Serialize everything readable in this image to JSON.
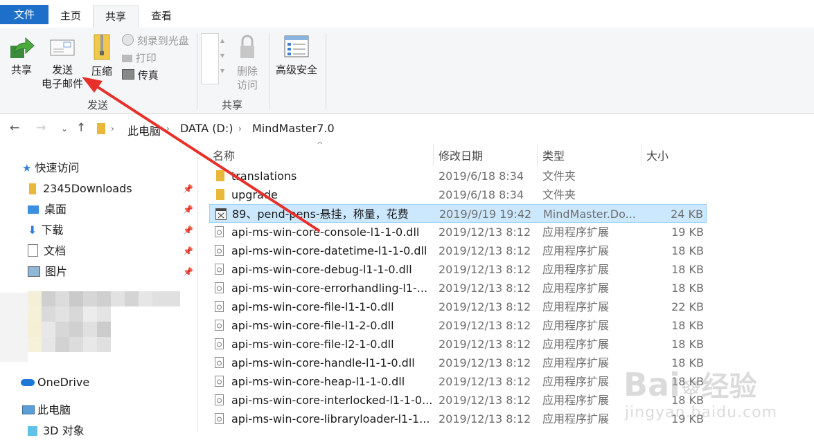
{
  "tabs": {
    "file": "文件",
    "home": "主页",
    "share": "共享",
    "view": "查看"
  },
  "ribbon": {
    "share": "共享",
    "send_email_line1": "发送",
    "send_email_line2": "电子邮件",
    "compress": "压缩",
    "burn": "刻录到光盘",
    "print": "打印",
    "fax": "传真",
    "remove_access_line1": "删除",
    "remove_access_line2": "访问",
    "advanced_security": "高级安全",
    "group_send": "发送",
    "group_share": "共享"
  },
  "address": {
    "this_pc": "此电脑",
    "drive": "DATA (D:)",
    "folder": "MindMaster7.0"
  },
  "nav_pane": {
    "quick_access": "快速访问",
    "items": [
      "2345Downloads",
      "桌面",
      "下载",
      "文档",
      "图片"
    ],
    "onedrive": "OneDrive",
    "this_pc": "此电脑",
    "objects_3d": "3D 对象"
  },
  "columns": {
    "name": "名称",
    "date": "修改日期",
    "type": "类型",
    "size": "大小"
  },
  "files": [
    {
      "name": "translations",
      "date": "2019/6/18 8:34",
      "type": "文件夹",
      "size": "",
      "icon": "folder-icon"
    },
    {
      "name": "upgrade",
      "date": "2019/6/18 8:34",
      "type": "文件夹",
      "size": "",
      "icon": "folder-icon"
    },
    {
      "name": "89、pend-pens-悬挂，称量，花费",
      "date": "2019/9/19 19:42",
      "type": "MindMaster.Do...",
      "size": "24 KB",
      "icon": "mindmaster-file-icon"
    },
    {
      "name": "api-ms-win-core-console-l1-1-0.dll",
      "date": "2019/12/13 8:12",
      "type": "应用程序扩展",
      "size": "19 KB",
      "icon": "dll-file-icon"
    },
    {
      "name": "api-ms-win-core-datetime-l1-1-0.dll",
      "date": "2019/12/13 8:12",
      "type": "应用程序扩展",
      "size": "18 KB",
      "icon": "dll-file-icon"
    },
    {
      "name": "api-ms-win-core-debug-l1-1-0.dll",
      "date": "2019/12/13 8:12",
      "type": "应用程序扩展",
      "size": "18 KB",
      "icon": "dll-file-icon"
    },
    {
      "name": "api-ms-win-core-errorhandling-l1-...",
      "date": "2019/12/13 8:12",
      "type": "应用程序扩展",
      "size": "18 KB",
      "icon": "dll-file-icon"
    },
    {
      "name": "api-ms-win-core-file-l1-1-0.dll",
      "date": "2019/12/13 8:12",
      "type": "应用程序扩展",
      "size": "22 KB",
      "icon": "dll-file-icon"
    },
    {
      "name": "api-ms-win-core-file-l1-2-0.dll",
      "date": "2019/12/13 8:12",
      "type": "应用程序扩展",
      "size": "18 KB",
      "icon": "dll-file-icon"
    },
    {
      "name": "api-ms-win-core-file-l2-1-0.dll",
      "date": "2019/12/13 8:12",
      "type": "应用程序扩展",
      "size": "18 KB",
      "icon": "dll-file-icon"
    },
    {
      "name": "api-ms-win-core-handle-l1-1-0.dll",
      "date": "2019/12/13 8:12",
      "type": "应用程序扩展",
      "size": "18 KB",
      "icon": "dll-file-icon"
    },
    {
      "name": "api-ms-win-core-heap-l1-1-0.dll",
      "date": "2019/12/13 8:12",
      "type": "应用程序扩展",
      "size": "18 KB",
      "icon": "dll-file-icon"
    },
    {
      "name": "api-ms-win-core-interlocked-l1-1-0...",
      "date": "2019/12/13 8:12",
      "type": "应用程序扩展",
      "size": "18 KB",
      "icon": "dll-file-icon"
    },
    {
      "name": "api-ms-win-core-libraryloader-l1-1...",
      "date": "2019/12/13 8:12",
      "type": "应用程序扩展",
      "size": "19 KB",
      "icon": "dll-file-icon"
    }
  ],
  "watermark": {
    "brand": "Bai",
    "brand_cn": "经验",
    "url": "jingyan.baidu.com"
  },
  "colors": {
    "accent": "#1e6fc9",
    "selection": "#cce8ff",
    "arrow": "#e8302a"
  }
}
